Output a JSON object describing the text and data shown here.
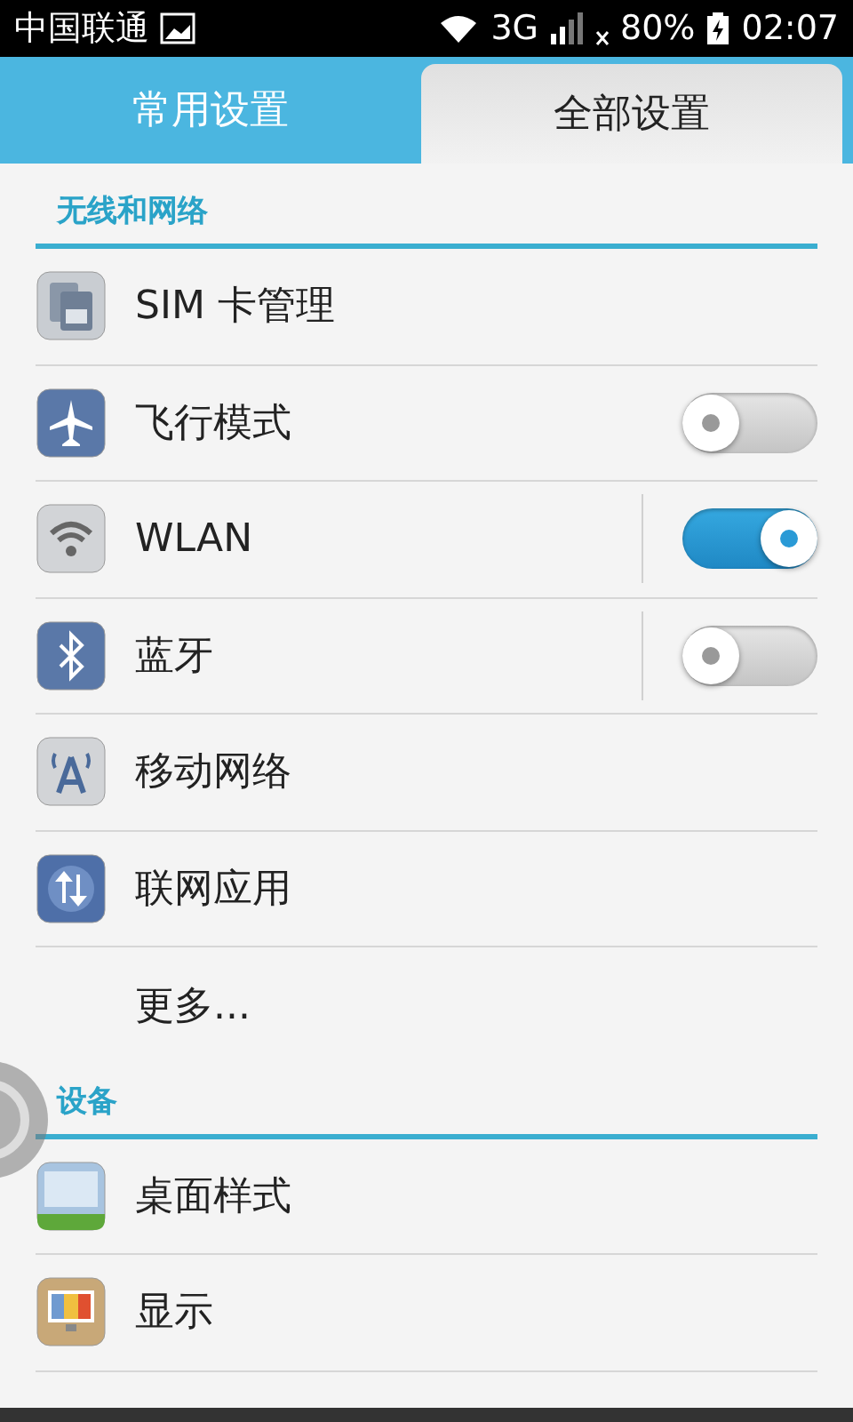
{
  "status_bar": {
    "carrier": "中国联通",
    "network": "3G",
    "battery": "80%",
    "time": "02:07"
  },
  "tabs": [
    {
      "label": "常用设置",
      "selected": false
    },
    {
      "label": "全部设置",
      "selected": true
    }
  ],
  "sections": [
    {
      "title": "无线和网络",
      "items": [
        {
          "label": "SIM 卡管理",
          "kind": "plain"
        },
        {
          "label": "飞行模式",
          "kind": "toggle",
          "on": false
        },
        {
          "label": "WLAN",
          "kind": "split_toggle",
          "on": true
        },
        {
          "label": "蓝牙",
          "kind": "split_toggle",
          "on": false
        },
        {
          "label": "移动网络",
          "kind": "plain"
        },
        {
          "label": "联网应用",
          "kind": "plain"
        },
        {
          "label": "更多...",
          "kind": "plain"
        }
      ]
    },
    {
      "title": "设备",
      "items": [
        {
          "label": "桌面样式",
          "kind": "plain"
        },
        {
          "label": "显示",
          "kind": "plain"
        }
      ]
    }
  ]
}
